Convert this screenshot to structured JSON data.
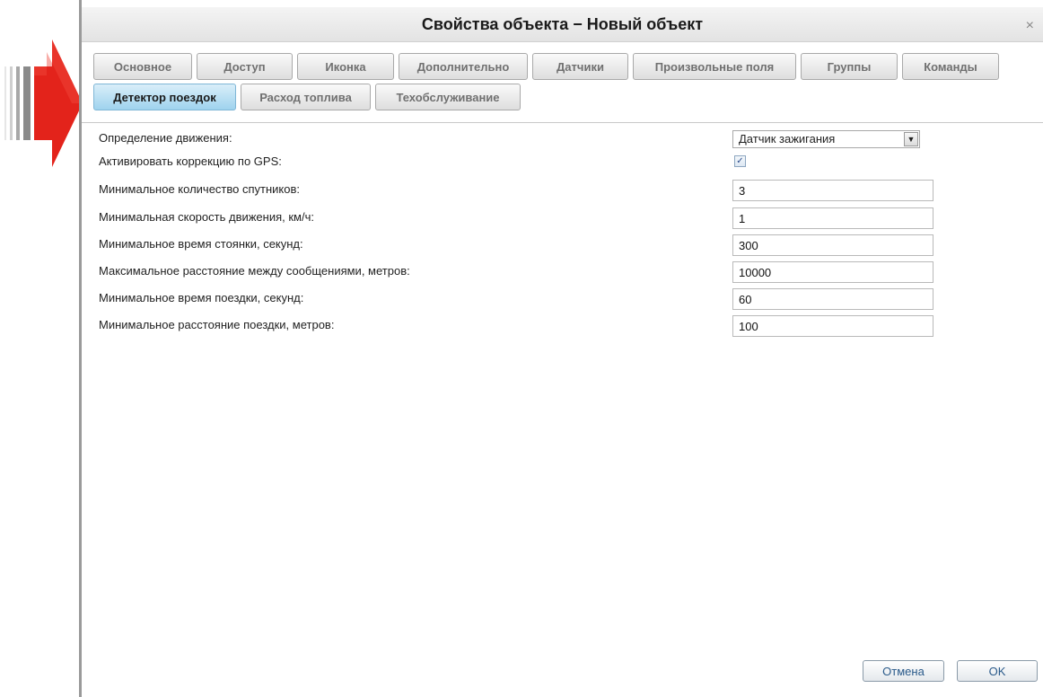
{
  "dialog": {
    "title": "Свойства объекта − Новый объект",
    "close_symbol": "×"
  },
  "tabs": {
    "row1": [
      "Основное",
      "Доступ",
      "Иконка",
      "Дополнительно",
      "Датчики",
      "Произвольные поля",
      "Группы",
      "Команды"
    ],
    "row2": [
      "Детектор поездок",
      "Расход топлива",
      "Техобслуживание"
    ],
    "active": "Детектор поездок"
  },
  "form": {
    "movement_detection": {
      "label": "Определение движения:",
      "value": "Датчик зажигания"
    },
    "gps_correction": {
      "label": "Активировать коррекцию по GPS:",
      "checked": true,
      "check_symbol": "✓"
    },
    "min_satellites": {
      "label": "Минимальное количество спутников:",
      "value": "3"
    },
    "min_speed": {
      "label": "Минимальная скорость движения, км/ч:",
      "value": "1"
    },
    "min_parking_time": {
      "label": "Минимальное время стоянки, секунд:",
      "value": "300"
    },
    "max_message_distance": {
      "label": "Максимальное расстояние между сообщениями, метров:",
      "value": "10000"
    },
    "min_trip_time": {
      "label": "Минимальное время поездки, секунд:",
      "value": "60"
    },
    "min_trip_distance": {
      "label": "Минимальное расстояние поездки, метров:",
      "value": "100"
    }
  },
  "buttons": {
    "cancel": "Отмена",
    "ok": "OK"
  },
  "colors": {
    "arrow": "#e3231b",
    "active_tab": "#9fd3ee",
    "button_text": "#2a5a8a"
  },
  "icons": {
    "arrow": "red-arrow-icon",
    "close": "close-icon",
    "dropdown": "chevron-down-icon",
    "check": "checkmark-icon"
  }
}
